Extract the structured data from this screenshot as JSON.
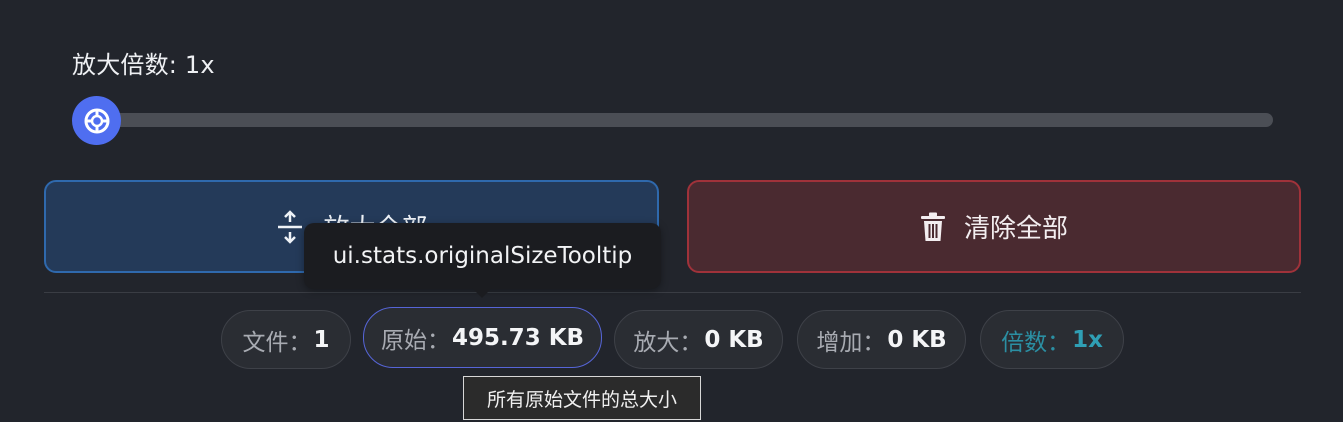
{
  "scale": {
    "label": "放大倍数: 1x",
    "value_fraction": 0
  },
  "buttons": {
    "enlarge_label": "放大全部",
    "clear_label": "清除全部"
  },
  "stats": {
    "files_label": "文件：",
    "files_value": "1",
    "original_label": "原始：",
    "original_value": "495.73 KB",
    "enlarged_label": "放大：",
    "enlarged_value": "0 KB",
    "increase_label": "增加：",
    "increase_value": "0 KB",
    "ratio_label": "倍数：",
    "ratio_value": "1x"
  },
  "tooltips": {
    "original_size_key": "ui.stats.originalSizeTooltip",
    "original_size_native": "所有原始文件的总大小"
  },
  "colors": {
    "background": "#22252c",
    "accent": "#4f6ef0",
    "enlarge_border": "#2f69ad",
    "clear_border": "#a0323a",
    "ratio_text": "#2f9fb5"
  },
  "icons": {
    "slider_thumb": "lifebuoy-icon",
    "enlarge": "expand-vertical-icon",
    "clear": "trash-icon"
  }
}
